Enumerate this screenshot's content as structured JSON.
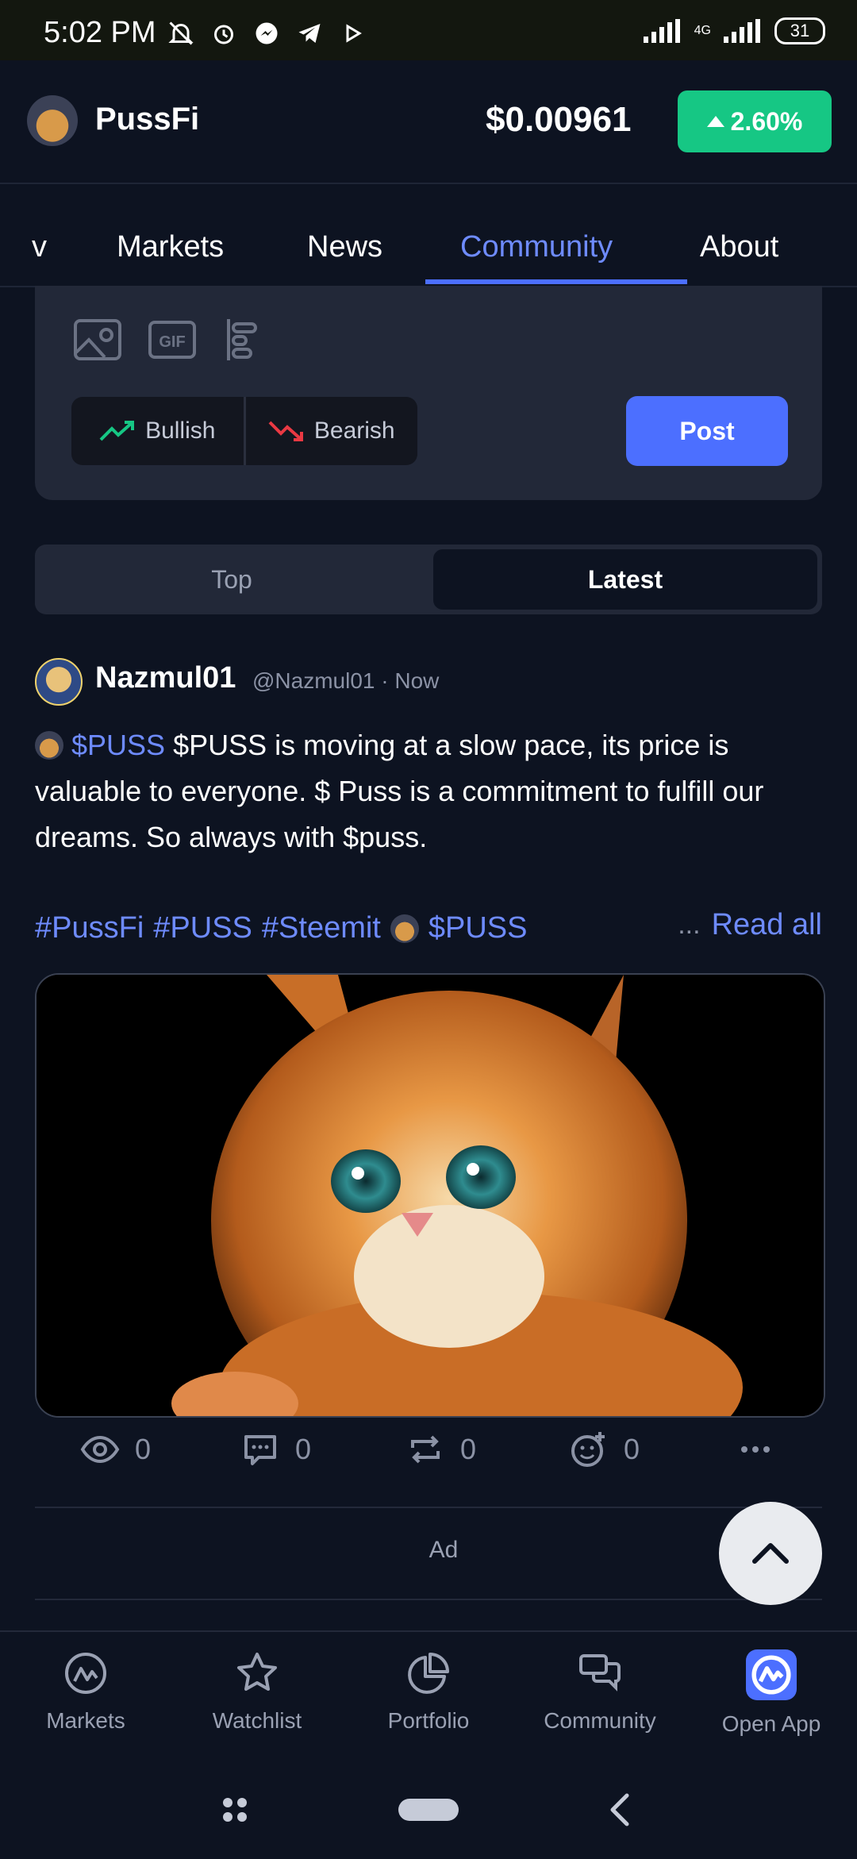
{
  "status": {
    "time": "5:02 PM",
    "network": "4G",
    "battery": "31"
  },
  "header": {
    "brand": "PussFi",
    "price": "$0.00961",
    "change": "2.60%"
  },
  "tabs": [
    {
      "label": "v"
    },
    {
      "label": "Markets"
    },
    {
      "label": "News"
    },
    {
      "label": "Community"
    },
    {
      "label": "About"
    }
  ],
  "composer": {
    "bullish": "Bullish",
    "bearish": "Bearish",
    "post": "Post"
  },
  "segment": {
    "top": "Top",
    "latest": "Latest"
  },
  "post": {
    "author": "Nazmul01",
    "handle": "@Nazmul01 · Now",
    "cashtag": "$PUSS",
    "text": "$PUSS is moving at a slow pace, its price is valuable to everyone. $ Puss is a commitment to fulfill our dreams. So always with $puss.",
    "hashtags": [
      "#PussFi",
      "#PUSS",
      "#Steemit"
    ],
    "hashtag_cashtag": "$PUSS",
    "read_more_dots": "...",
    "read_all": "Read all",
    "stats": {
      "views": "0",
      "comments": "0",
      "reposts": "0",
      "reactions": "0"
    }
  },
  "ad_label": "Ad",
  "bottom_nav": [
    {
      "label": "Markets"
    },
    {
      "label": "Watchlist"
    },
    {
      "label": "Portfolio"
    },
    {
      "label": "Community"
    },
    {
      "label": "Open App"
    }
  ],
  "colors": {
    "accent": "#4c6fff",
    "up": "#16c784",
    "down": "#ea3943",
    "background": "#0d1321"
  }
}
